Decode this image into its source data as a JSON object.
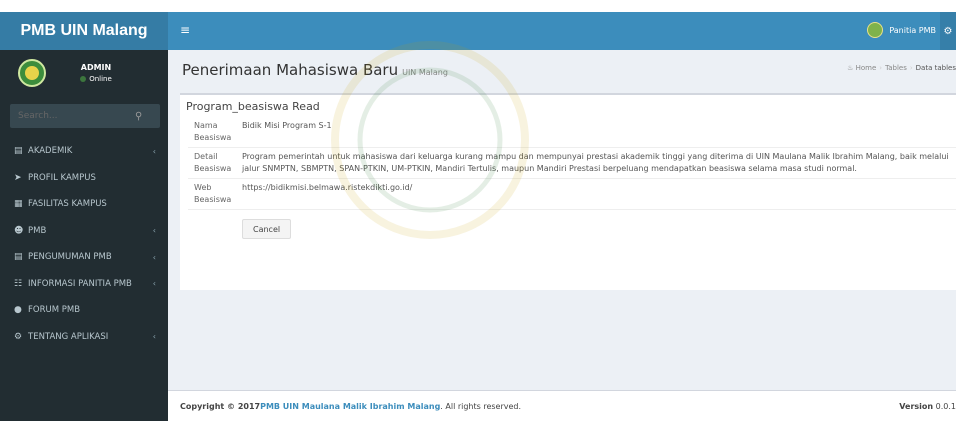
{
  "brand": "PMB UIN Malang",
  "user": {
    "name": "ADMIN",
    "status": "Online"
  },
  "search": {
    "placeholder": "Search..."
  },
  "menu": [
    {
      "label": "AKADEMIK",
      "icon": "bank-icon",
      "chevron": true
    },
    {
      "label": "PROFIL KAMPUS",
      "icon": "rocket-icon",
      "chevron": false
    },
    {
      "label": "FASILITAS KAMPUS",
      "icon": "building-icon",
      "chevron": false
    },
    {
      "label": "PMB",
      "icon": "user-plus-icon",
      "chevron": true
    },
    {
      "label": "PENGUMUMAN PMB",
      "icon": "bank-icon",
      "chevron": true
    },
    {
      "label": "INFORMASI PANITIA PMB",
      "icon": "sitemap-icon",
      "chevron": true
    },
    {
      "label": "FORUM PMB",
      "icon": "comments-icon",
      "chevron": false
    },
    {
      "label": "TENTANG APLIKASI",
      "icon": "gear-icon",
      "chevron": true
    }
  ],
  "header": {
    "menu_icon": "≡",
    "user_label": "Panitia PMB"
  },
  "page": {
    "title": "Penerimaan Mahasiswa Baru",
    "subtitle": "UIN Malang"
  },
  "breadcrumb": {
    "home": "Home",
    "tables": "Tables",
    "current": "Data tables"
  },
  "box": {
    "title": "Program_beasiswa Read",
    "rows": [
      {
        "label": "Nama Beasiswa",
        "value": "Bidik Misi Program S-1"
      },
      {
        "label": "Detail Beasiswa",
        "value": "Program pemerintah untuk mahasiswa dari keluarga kurang mampu dan mempunyai prestasi akademik tinggi yang diterima di UIN Maulana Malik Ibrahim Malang, baik melalui jalur SNMPTN, SBMPTN, SPAN-PTKIN, UM-PTKIN, Mandiri Tertulis, maupun Mandiri Prestasi berpeluang mendapatkan beasiswa selama masa studi normal."
      },
      {
        "label": "Web Beasiswa",
        "value": "https://bidikmisi.belmawa.ristekdikti.go.id/"
      }
    ],
    "cancel_label": "Cancel"
  },
  "footer": {
    "copyright_prefix": "Copyright © 2017 ",
    "link": "PMB UIN Maulana Malik Ibrahim Malang",
    "suffix": ". All rights reserved.",
    "version_label": "Version",
    "version_value": "0.0.1"
  },
  "colors": {
    "sidebar": "#222d32",
    "header": "#3c8dbc",
    "logo": "#357ca5",
    "content_bg": "#ecf0f5"
  }
}
